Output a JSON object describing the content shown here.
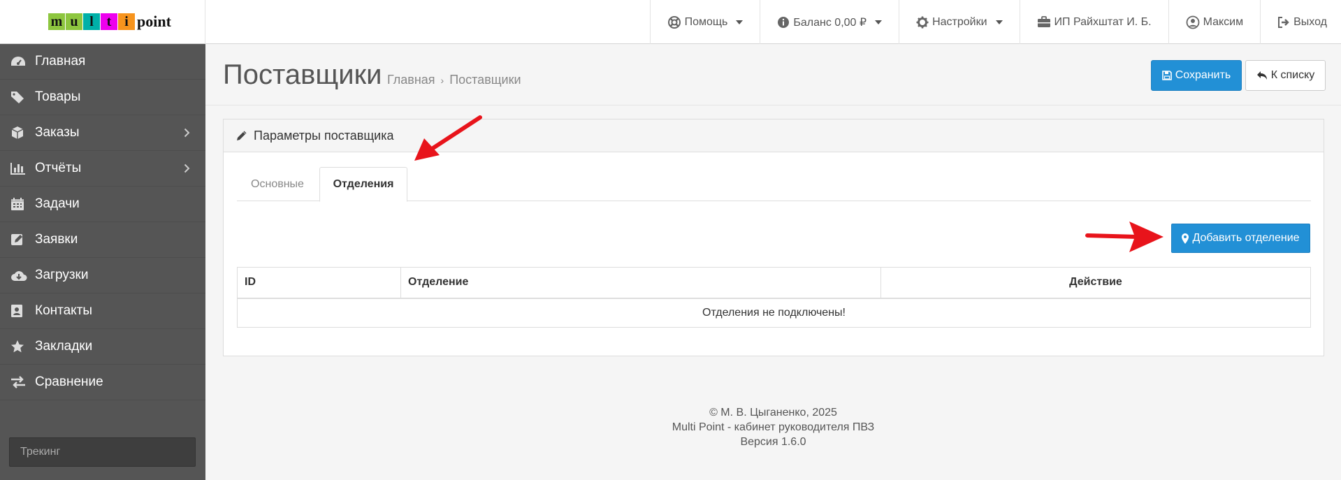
{
  "logo": {
    "letters": [
      "m",
      "u",
      "l",
      "t",
      "i"
    ],
    "letter_colors": [
      "#8dc63f",
      "#8dc63f",
      "#00b0a8",
      "#ee00ee",
      "#f7941d"
    ],
    "suffix": "point"
  },
  "topnav": {
    "help": "Помощь",
    "balance": "Баланс 0,00 ₽",
    "settings": "Настройки",
    "org": "ИП Райхштат И. Б.",
    "user": "Максим",
    "logout": "Выход"
  },
  "sidebar": {
    "items": [
      {
        "label": "Главная",
        "icon": "dashboard-icon",
        "has_children": false
      },
      {
        "label": "Товары",
        "icon": "tags-icon",
        "has_children": false
      },
      {
        "label": "Заказы",
        "icon": "cube-icon",
        "has_children": true
      },
      {
        "label": "Отчёты",
        "icon": "bar-chart-icon",
        "has_children": true
      },
      {
        "label": "Задачи",
        "icon": "calendar-icon",
        "has_children": false
      },
      {
        "label": "Заявки",
        "icon": "edit-icon",
        "has_children": false
      },
      {
        "label": "Загрузки",
        "icon": "cloud-download-icon",
        "has_children": false
      },
      {
        "label": "Контакты",
        "icon": "address-book-icon",
        "has_children": false
      },
      {
        "label": "Закладки",
        "icon": "star-icon",
        "has_children": false
      },
      {
        "label": "Сравнение",
        "icon": "exchange-icon",
        "has_children": false
      }
    ],
    "tracking_placeholder": "Трекинг"
  },
  "page": {
    "title": "Поставщики",
    "breadcrumb": [
      "Главная",
      "Поставщики"
    ],
    "save_label": "Сохранить",
    "back_label": "К списку"
  },
  "panel": {
    "title": "Параметры поставщика",
    "tabs": [
      {
        "label": "Основные",
        "active": false
      },
      {
        "label": "Отделения",
        "active": true
      }
    ],
    "add_label": "Добавить отделение",
    "table": {
      "columns": [
        "ID",
        "Отделение",
        "Действие"
      ],
      "empty_text": "Отделения не подключены!"
    }
  },
  "footer": {
    "copyright": "© М. В. Цыганенко, 2025",
    "product": "Multi Point - кабинет руководителя ПВЗ",
    "version": "Версия 1.6.0"
  },
  "colors": {
    "primary": "#2290d6",
    "sidebar": "#555555",
    "annotation_arrow": "#e8141b"
  }
}
